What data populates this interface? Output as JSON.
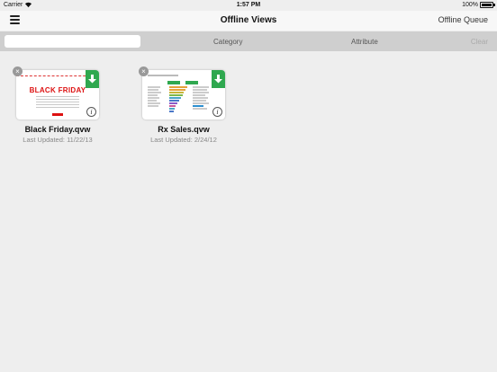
{
  "status_bar": {
    "carrier": "Carrier",
    "time": "1:57 PM",
    "battery": "100%"
  },
  "nav": {
    "title": "Offline Views",
    "right_button": "Offline Queue"
  },
  "filter_bar": {
    "search_placeholder": "",
    "category_label": "Category",
    "attribute_label": "Attribute",
    "clear_label": "Clear"
  },
  "documents": [
    {
      "name": "Black Friday.qvw",
      "last_updated": "Last Updated: 11/22/13",
      "thumbnail_text": "BLACK FRIDAY"
    },
    {
      "name": "Rx Sales.qvw",
      "last_updated": "Last Updated: 2/24/12"
    }
  ],
  "icons": {
    "menu": "hamburger-menu-icon",
    "delete": "close-icon",
    "download": "download-arrow-icon",
    "info": "info-icon"
  },
  "colors": {
    "download_badge": "#2fa84f",
    "black_friday_red": "#dd1111",
    "filter_bar_bg": "#cfcfcf"
  }
}
